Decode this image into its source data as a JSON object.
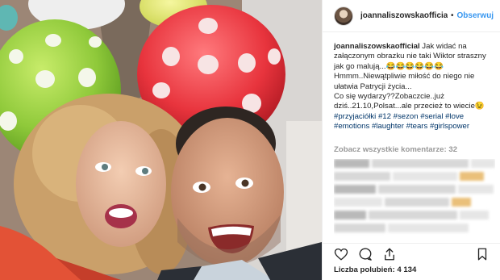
{
  "post": {
    "header": {
      "username": "joannaliszowskaofficia",
      "separator": "•",
      "follow_label": "Obserwuj"
    },
    "caption": {
      "username": "joannaliszowskaofficial",
      "line1": " Jak widać na załączonym obrazku nie taki Wiktor straszny jak go malują...😂😂😂😂😂😂",
      "line2": "Hmmm..Niewątpliwie miłość do niego nie ułatwia Patrycji życia...",
      "line3": "Co się wydarzy??Zobaczcie..już dziś..21.10,Polsat...ale przecież to wiecie😉",
      "hashtags": [
        "#przyjaciółki",
        "#12",
        "#sezon",
        "#serial",
        "#love",
        "#emotions",
        "#laughter",
        "#tears",
        "#girlspower"
      ]
    },
    "view_all_comments": "Zobacz wszystkie komentarze: 32",
    "likes_text": "Liczba polubień: 4 134"
  },
  "icons": {
    "heart": "heart-icon",
    "comment": "comment-icon",
    "share": "share-icon",
    "save": "bookmark-icon",
    "avatar": "avatar"
  },
  "colors": {
    "link_blue": "#3897f0",
    "hashtag_blue": "#003569",
    "muted_gray": "#999999",
    "text": "#262626",
    "balloon_green": "#8fc93a",
    "balloon_red": "#e8343d"
  }
}
